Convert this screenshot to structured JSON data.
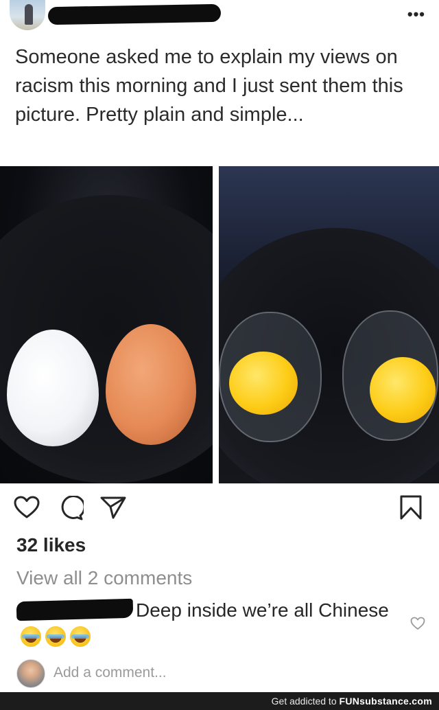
{
  "post": {
    "caption": "Someone asked me to explain my views on racism this morning and I just sent them this picture. Pretty plain and simple...",
    "more_label": "•••"
  },
  "stats": {
    "likes": "32 likes",
    "view_comments": "View all 2 comments"
  },
  "comment": {
    "text": "Deep inside we’re all Chinese"
  },
  "composer": {
    "placeholder": "Add a comment..."
  },
  "footer": {
    "prefix": "Get addicted to",
    "brand": "FUNsubstance.com"
  },
  "icons": [
    "heart-icon",
    "comment-icon",
    "share-icon",
    "bookmark-icon",
    "more-icon",
    "small-heart-icon"
  ]
}
